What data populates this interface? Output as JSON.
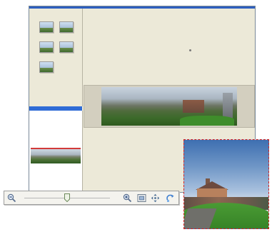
{
  "window": {
    "title": ""
  },
  "thumbnails": [
    {
      "name": "thumbnail-1"
    },
    {
      "name": "thumbnail-2"
    },
    {
      "name": "thumbnail-3"
    },
    {
      "name": "thumbnail-4"
    },
    {
      "name": "thumbnail-5"
    }
  ],
  "zoom_toolbar": {
    "icons": [
      "zoom-out-icon",
      "zoom-in-icon",
      "fit-to-window-icon",
      "pan-icon",
      "rotate-icon"
    ],
    "slider_level": 0.5
  },
  "colors": {
    "accent": "#2f6cd6",
    "selection": "#d23a3a",
    "loupe_border": "#d42121"
  }
}
